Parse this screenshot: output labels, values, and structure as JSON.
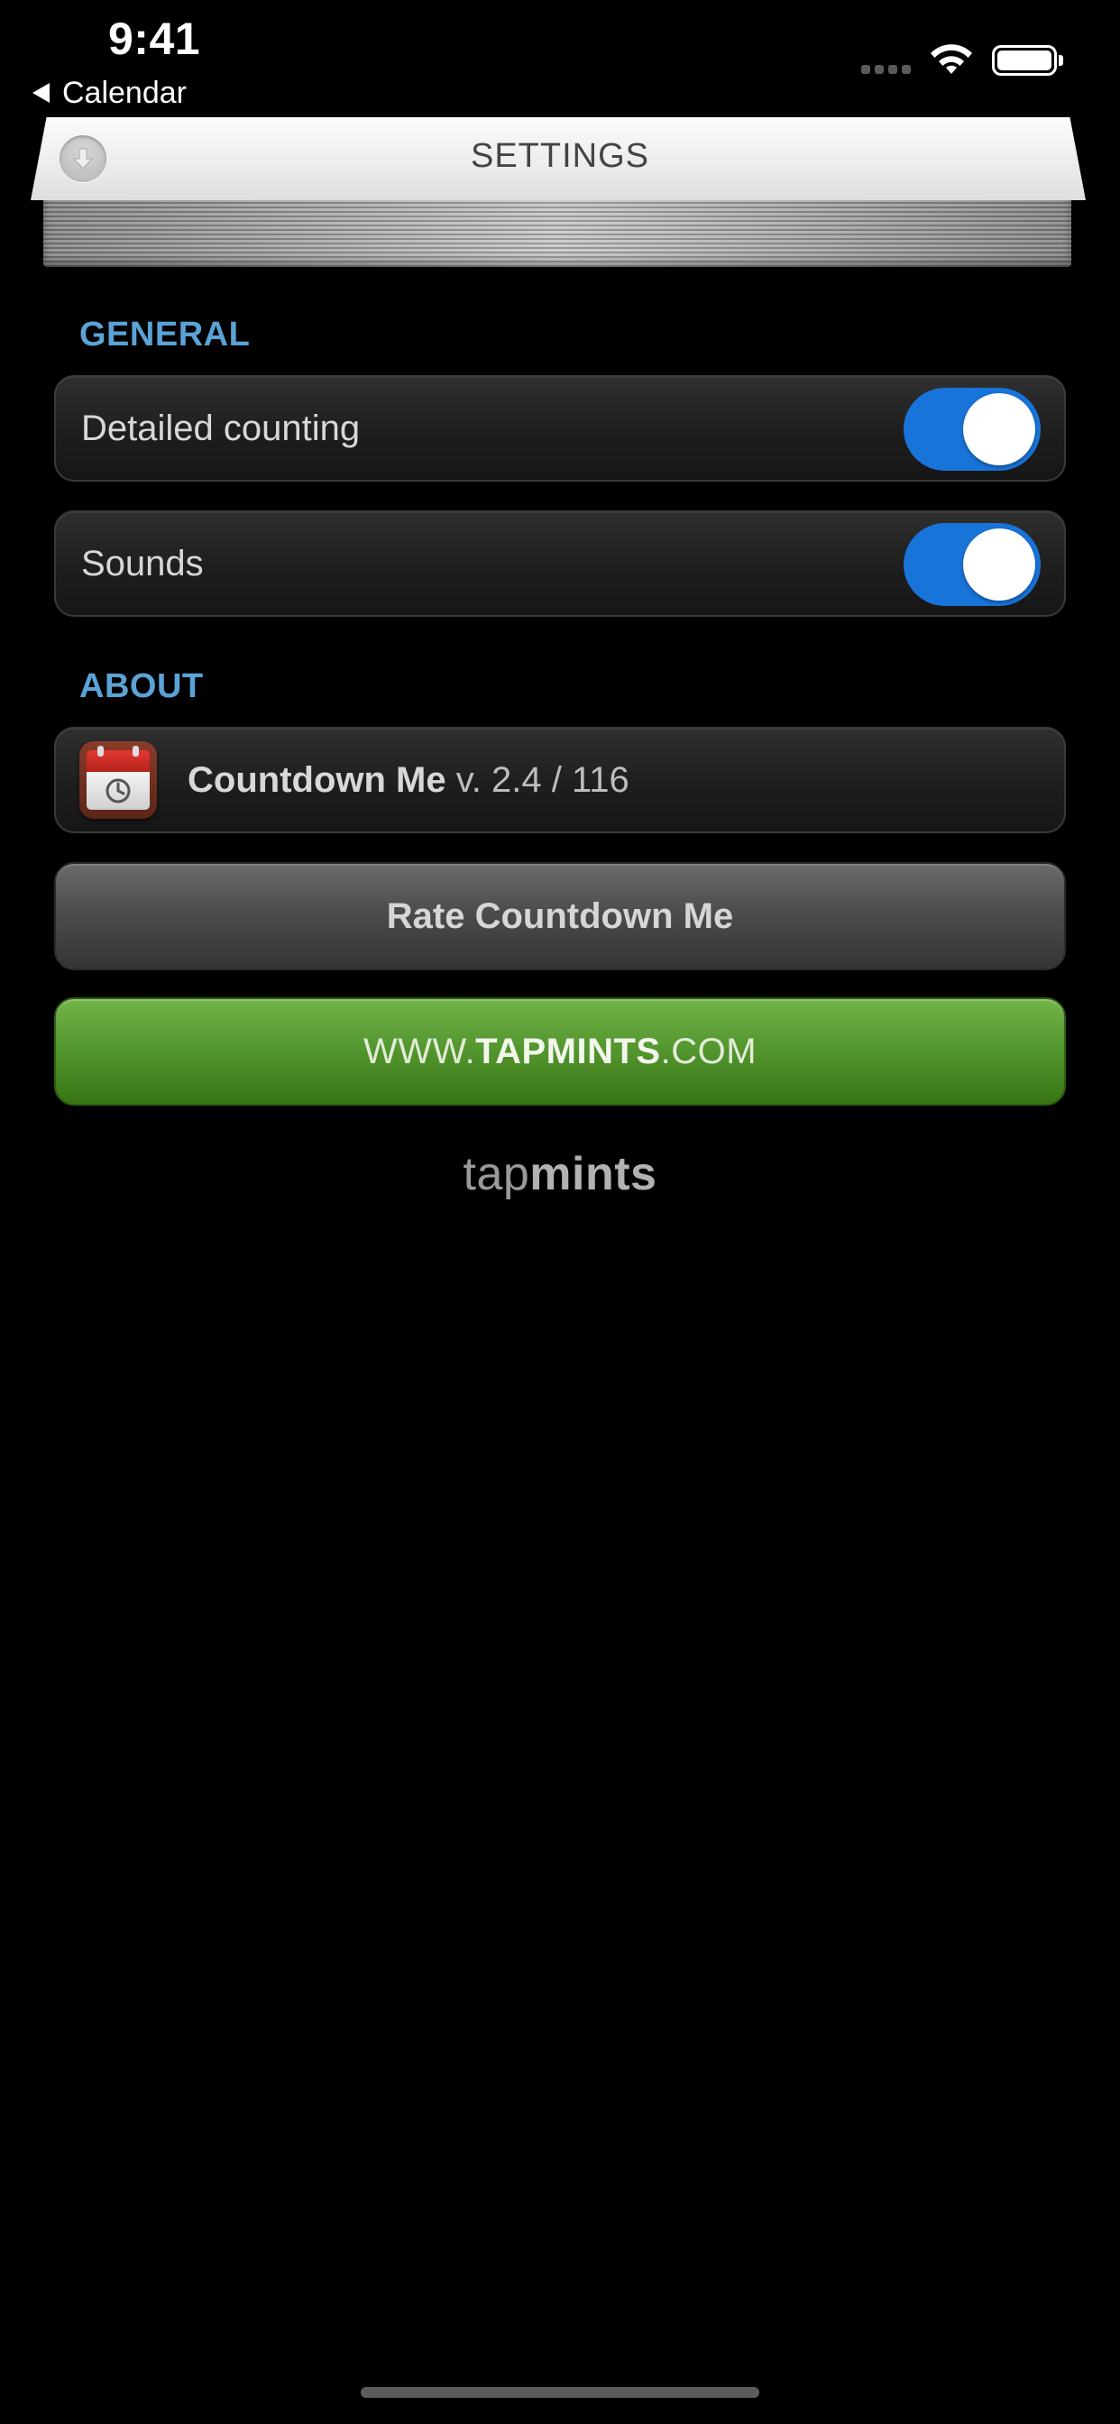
{
  "status_bar": {
    "time": "9:41",
    "back_label": "Calendar"
  },
  "header": {
    "title": "SETTINGS"
  },
  "general": {
    "section_title": "GENERAL",
    "items": [
      {
        "label": "Detailed counting",
        "enabled": true
      },
      {
        "label": "Sounds",
        "enabled": true
      }
    ]
  },
  "about": {
    "section_title": "ABOUT",
    "app_name": "Countdown Me",
    "version": "v. 2.4 / 116",
    "rate_label": "Rate Countdown Me",
    "website": {
      "prefix": "WWW.",
      "brand": "TAPMINTS",
      "suffix": ".COM"
    }
  },
  "brand": {
    "light": "tap",
    "bold": "mints"
  },
  "colors": {
    "accent_blue": "#1874d9",
    "section_header": "#5aa3d6",
    "website_green": "#52942d"
  },
  "icons": [
    "back-arrow-icon",
    "wifi-icon",
    "battery-icon",
    "collapse-arrow-icon",
    "calendar-app-icon"
  ]
}
